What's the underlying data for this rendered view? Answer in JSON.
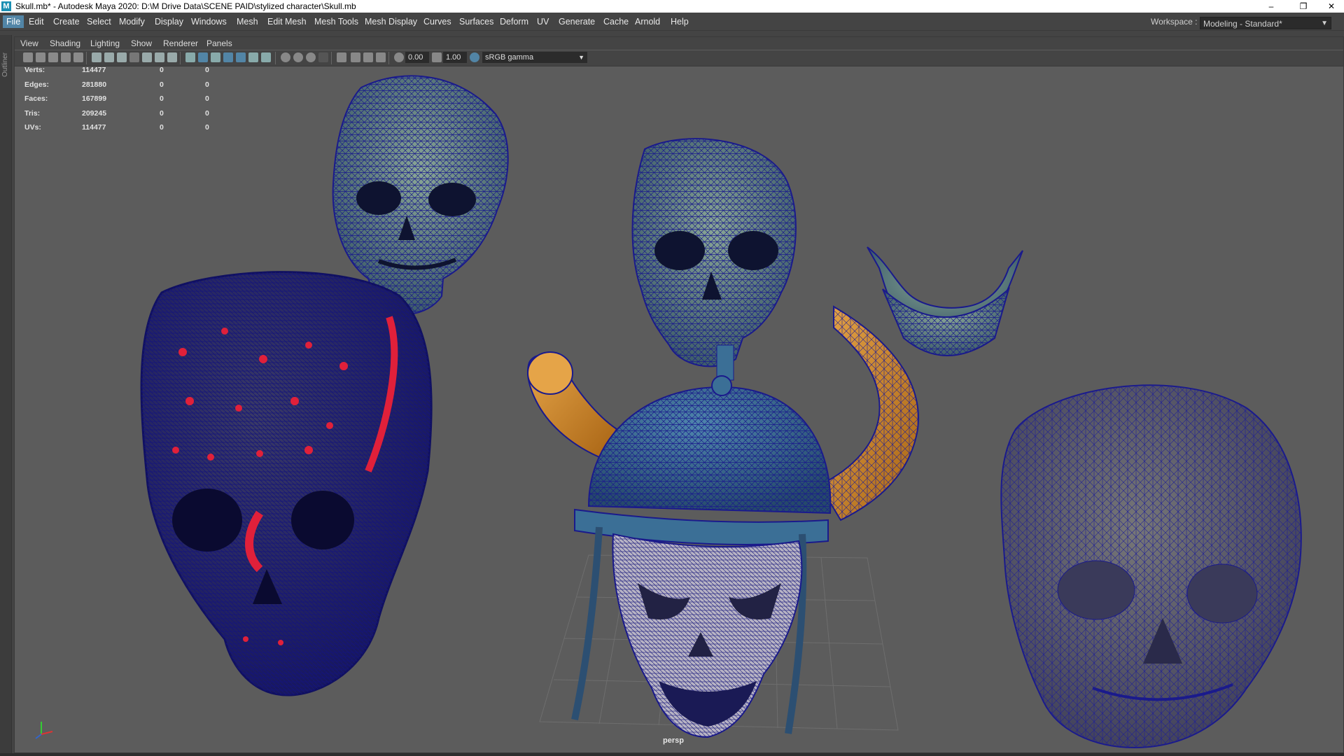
{
  "window": {
    "app_icon": "M",
    "title": "Skull.mb* - Autodesk Maya 2020: D:\\M Drive Data\\SCENE PAID\\stylized character\\Skull.mb",
    "controls": [
      "–",
      "❐",
      "✕"
    ]
  },
  "menubar": {
    "items": [
      "File",
      "Edit",
      "Create",
      "Select",
      "Modify",
      "Display",
      "Windows",
      "Mesh",
      "Edit Mesh",
      "Mesh Tools",
      "Mesh Display",
      "Curves",
      "Surfaces",
      "Deform",
      "UV",
      "Generate",
      "Cache",
      "Arnold",
      "Help"
    ],
    "active": "File"
  },
  "workspace": {
    "label": "Workspace :",
    "value": "Modeling - Standard*"
  },
  "outliner": {
    "label": "Outliner"
  },
  "panel_menu": {
    "items": [
      "View",
      "Shading",
      "Lighting",
      "Show",
      "Renderer",
      "Panels"
    ]
  },
  "panel_toolbar": {
    "exposure": "0.00",
    "gamma": "1.00",
    "color_space": "sRGB gamma"
  },
  "hud": {
    "rows": [
      {
        "label": "Verts:",
        "value": "114477",
        "c1": "0",
        "c2": "0"
      },
      {
        "label": "Edges:",
        "value": "281880",
        "c1": "0",
        "c2": "0"
      },
      {
        "label": "Faces:",
        "value": "167899",
        "c1": "0",
        "c2": "0"
      },
      {
        "label": "Tris:",
        "value": "209245",
        "c1": "0",
        "c2": "0"
      },
      {
        "label": "UVs:",
        "value": "114477",
        "c1": "0",
        "c2": "0"
      }
    ]
  },
  "viewport": {
    "camera": "persp"
  },
  "colors": {
    "wire": "#1a1a8c",
    "skull_fill": "#6f8f80",
    "helmet_fill": "#3b6f96",
    "horn_fill": "#d9932e",
    "red_detail": "#e0203a",
    "viewport_bg": "#5c5c5c",
    "accent": "#5285a6"
  }
}
